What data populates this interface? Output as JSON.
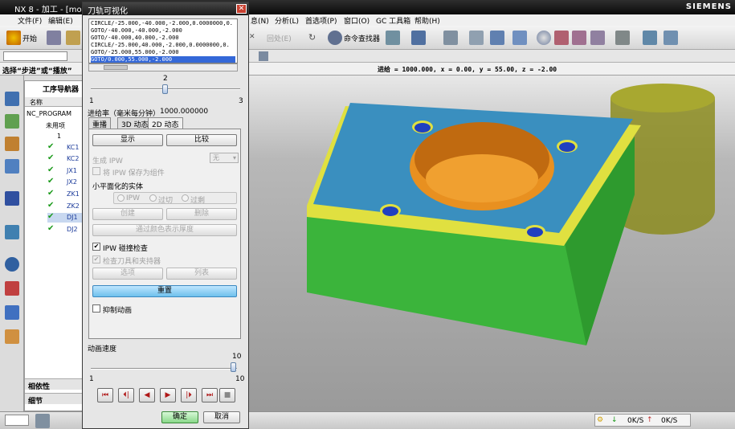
{
  "app": {
    "title": "NX 8 - 加工 - [mode",
    "brand": "SIEMENS"
  },
  "menu": [
    "文件(F)",
    "编辑(E)",
    "息(N)",
    "分析(L)",
    "首选项(P)",
    "窗口(O)",
    "GC 工具箱",
    "帮助(H)"
  ],
  "toolbar": {
    "start": "开始",
    "command_finder": "命令查找器",
    "disabled_item": "回处(E)"
  },
  "prompt": "选择“步进”或“播放”",
  "readout": "进给 = 1000.000,  x = 0.00,  y = 55.00,  z = -2.00",
  "navigator": {
    "title": "工序导航器",
    "col": "名称",
    "root": "NC_PROGRAM",
    "unused": "未用项",
    "group": "1",
    "items": [
      "KC1",
      "KC2",
      "JX1",
      "JX2",
      "ZK1",
      "ZK2",
      "DJ1",
      "DJ2"
    ],
    "footer1": "相依性",
    "footer2": "细节"
  },
  "dialog": {
    "title": "刀轨可视化",
    "gcode": [
      "CIRCLE/-25.000,-40.000,-2.000,0.0000000,0.",
      "GOTO/-40.000,-40.000,-2.000",
      "GOTO/-40.000,40.000,-2.000",
      "CIRCLE/-25.000,40.000,-2.000,0.0000000,0.",
      "GOTO/-25.000,55.000,-2.000",
      "GOTO/0.000,55.000,-2.000"
    ],
    "slider": {
      "min": "1",
      "max": "3",
      "value": "2",
      "fraction": 0.5
    },
    "feed_label": "进给率（毫米每分钟）",
    "feed_value": "1000.000000",
    "tabs": [
      "重播",
      "3D 动态",
      "2D 动态"
    ],
    "display": "显示",
    "compare": "比较",
    "gen_ipw": "生成 IPW",
    "gen_ipw_value": "无",
    "save_ipw": "将 IPW 保存为组件",
    "facet_label": "小平面化的实体",
    "radios": [
      "IPW",
      "过切",
      "过剩"
    ],
    "create": "创建",
    "delete": "删除",
    "thickness": "通过颜色表示厚度",
    "collision": "IPW 碰撞检查",
    "check_tool": "检查刀具和夹持器",
    "options": "选项",
    "list": "列表",
    "reset": "重置",
    "suppress": "抑制动画",
    "speed_label": "动画速度",
    "speed": {
      "min": "1",
      "max": "10",
      "value": "10",
      "fraction": 1.0
    },
    "ok": "确定",
    "cancel": "取消"
  },
  "status": {
    "rate1": "0K/S",
    "rate2": "0K/S"
  },
  "colors": {
    "top": "#3a8fbf",
    "sides": "#3bb43b",
    "chamfer": "#e0e040",
    "pocket": "#e89020",
    "hole": "#2040c0"
  }
}
